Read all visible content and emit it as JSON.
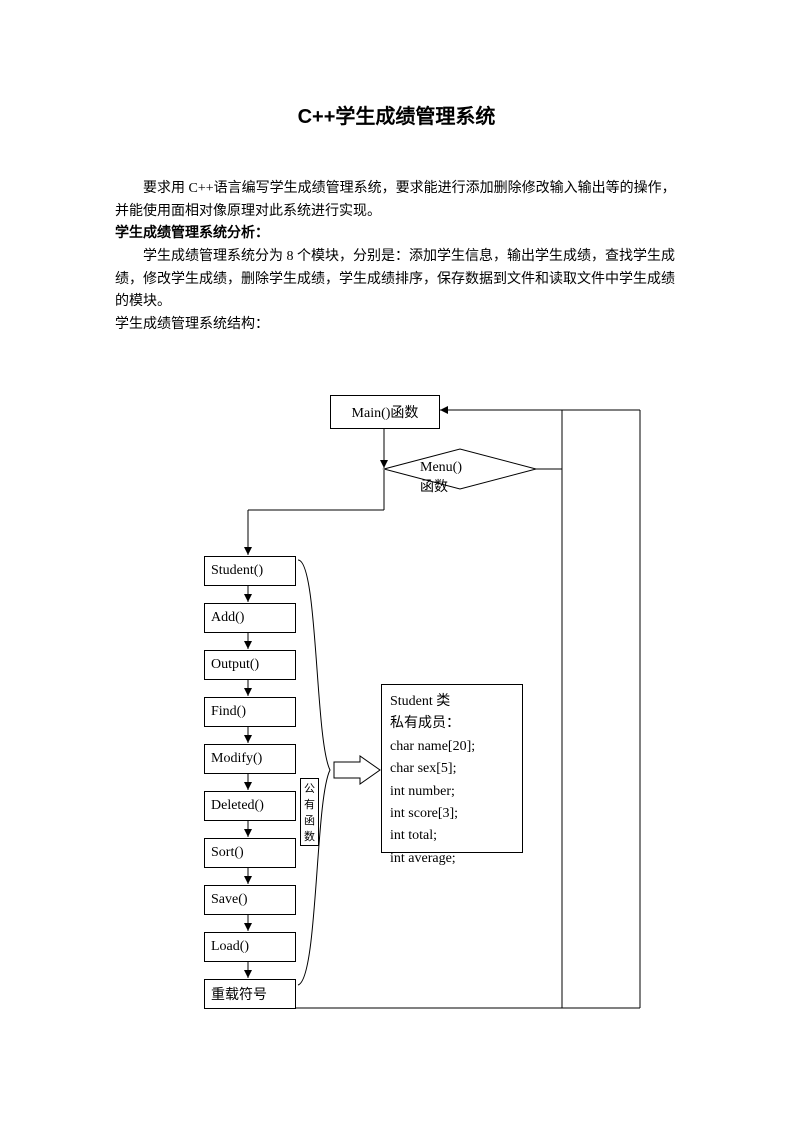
{
  "title": "C++学生成绩管理系统",
  "intro": {
    "p1": "要求用 C++语言编写学生成绩管理系统，要求能进行添加删除修改输入输出等的操作，并能使用面相对像原理对此系统进行实现。",
    "heading1": "学生成绩管理系统分析：",
    "p2": "学生成绩管理系统分为 8 个模块，分别是：添加学生信息，输出学生成绩，查找学生成绩，修改学生成绩，删除学生成绩，学生成绩排序，保存数据到文件和读取文件中学生成绩的模块。",
    "p3": "学生成绩管理系统结构："
  },
  "diagram": {
    "main": "Main()函数",
    "menu": "Menu()函数",
    "arrow_label": "公有函数",
    "functions": [
      "Student()",
      "Add()",
      "Output()",
      "Find()",
      "Modify()",
      "Deleted()",
      "Sort()",
      "Save()",
      "Load()",
      "重载符号"
    ],
    "class_box": {
      "title": "Student 类",
      "subtitle": "私有成员：",
      "members": [
        "char name[20];",
        "char sex[5];",
        "int number;",
        "int score[3];",
        "int total;",
        "int average;"
      ]
    }
  }
}
